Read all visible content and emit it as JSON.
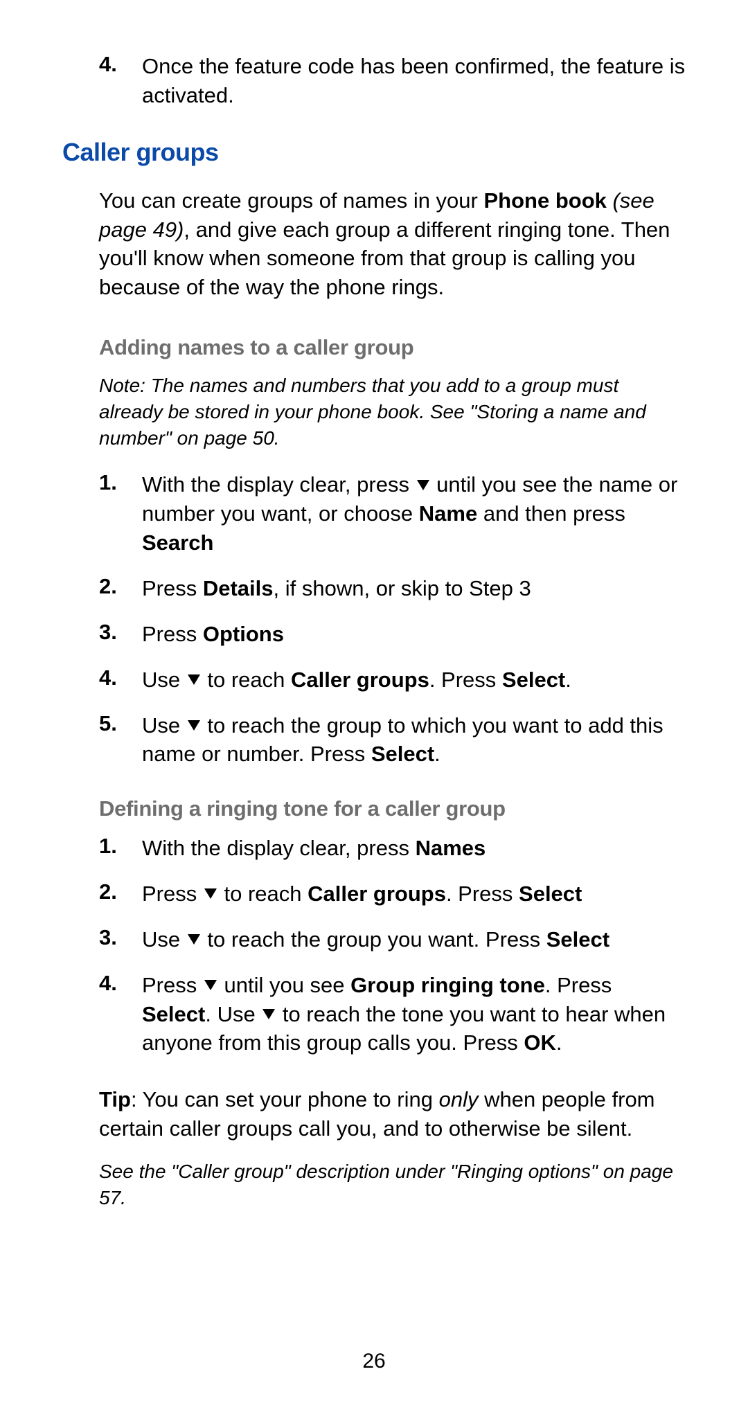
{
  "top_list": {
    "item4_num": "4.",
    "item4_text": "Once the feature code has been confirmed, the feature is activated."
  },
  "section": {
    "title": "Caller groups",
    "intro_p1a": "You can create groups of names in your ",
    "intro_bold": "Phone book",
    "intro_italic": " (see page 49)",
    "intro_p1b": ", and give each group a different ringing tone. Then you'll know when someone from that group is calling you because of the way the phone rings.",
    "sub1_title": "Adding names to a caller group",
    "sub1_note": "Note: The names and numbers that you add to a group must already be stored in your phone book. See \"Storing a name and number\" on page 50.",
    "s1_n1": "1.",
    "s1_t1a": "With the display clear, press ",
    "s1_t1b": " until you see the name or number you want, or choose ",
    "s1_t1_bold1": "Name",
    "s1_t1c": " and then press ",
    "s1_t1_bold2": "Search",
    "s1_n2": "2.",
    "s1_t2a": "Press ",
    "s1_t2_bold": "Details",
    "s1_t2b": ", if shown, or skip to Step 3",
    "s1_n3": "3.",
    "s1_t3a": "Press ",
    "s1_t3_bold": "Options",
    "s1_n4": "4.",
    "s1_t4a": "Use ",
    "s1_t4b": " to reach ",
    "s1_t4_bold1": "Caller groups",
    "s1_t4c": ". Press ",
    "s1_t4_bold2": "Select",
    "s1_t4d": ".",
    "s1_n5": "5.",
    "s1_t5a": "Use ",
    "s1_t5b": " to reach the group to which you want to add this name or number. Press ",
    "s1_t5_bold": "Select",
    "s1_t5c": ".",
    "sub2_title": "Defining a ringing tone for a caller group",
    "s2_n1": "1.",
    "s2_t1a": "With the display clear, press ",
    "s2_t1_bold": "Names",
    "s2_n2": "2.",
    "s2_t2a": "Press ",
    "s2_t2b": " to reach ",
    "s2_t2_bold1": "Caller groups",
    "s2_t2c": ". Press ",
    "s2_t2_bold2": "Select",
    "s2_n3": "3.",
    "s2_t3a": "Use ",
    "s2_t3b": " to reach the group you want. Press ",
    "s2_t3_bold": "Select",
    "s2_n4": "4.",
    "s2_t4a": "Press ",
    "s2_t4b": " until you see ",
    "s2_t4_bold1": "Group ringing tone",
    "s2_t4c": ". Press ",
    "s2_t4_bold2": "Select",
    "s2_t4d": ". Use ",
    "s2_t4e": " to reach the tone you want to hear when anyone from this group calls you. Press ",
    "s2_t4_bold3": "OK",
    "s2_t4f": ".",
    "tip_label": "Tip",
    "tip_a": ": You can set your phone to ring ",
    "tip_italic": "only",
    "tip_b": " when people from certain caller groups call you, and to otherwise be silent.",
    "ref": "See the \"Caller group\" description under \"Ringing options\" on page 57."
  },
  "page_number": "26"
}
